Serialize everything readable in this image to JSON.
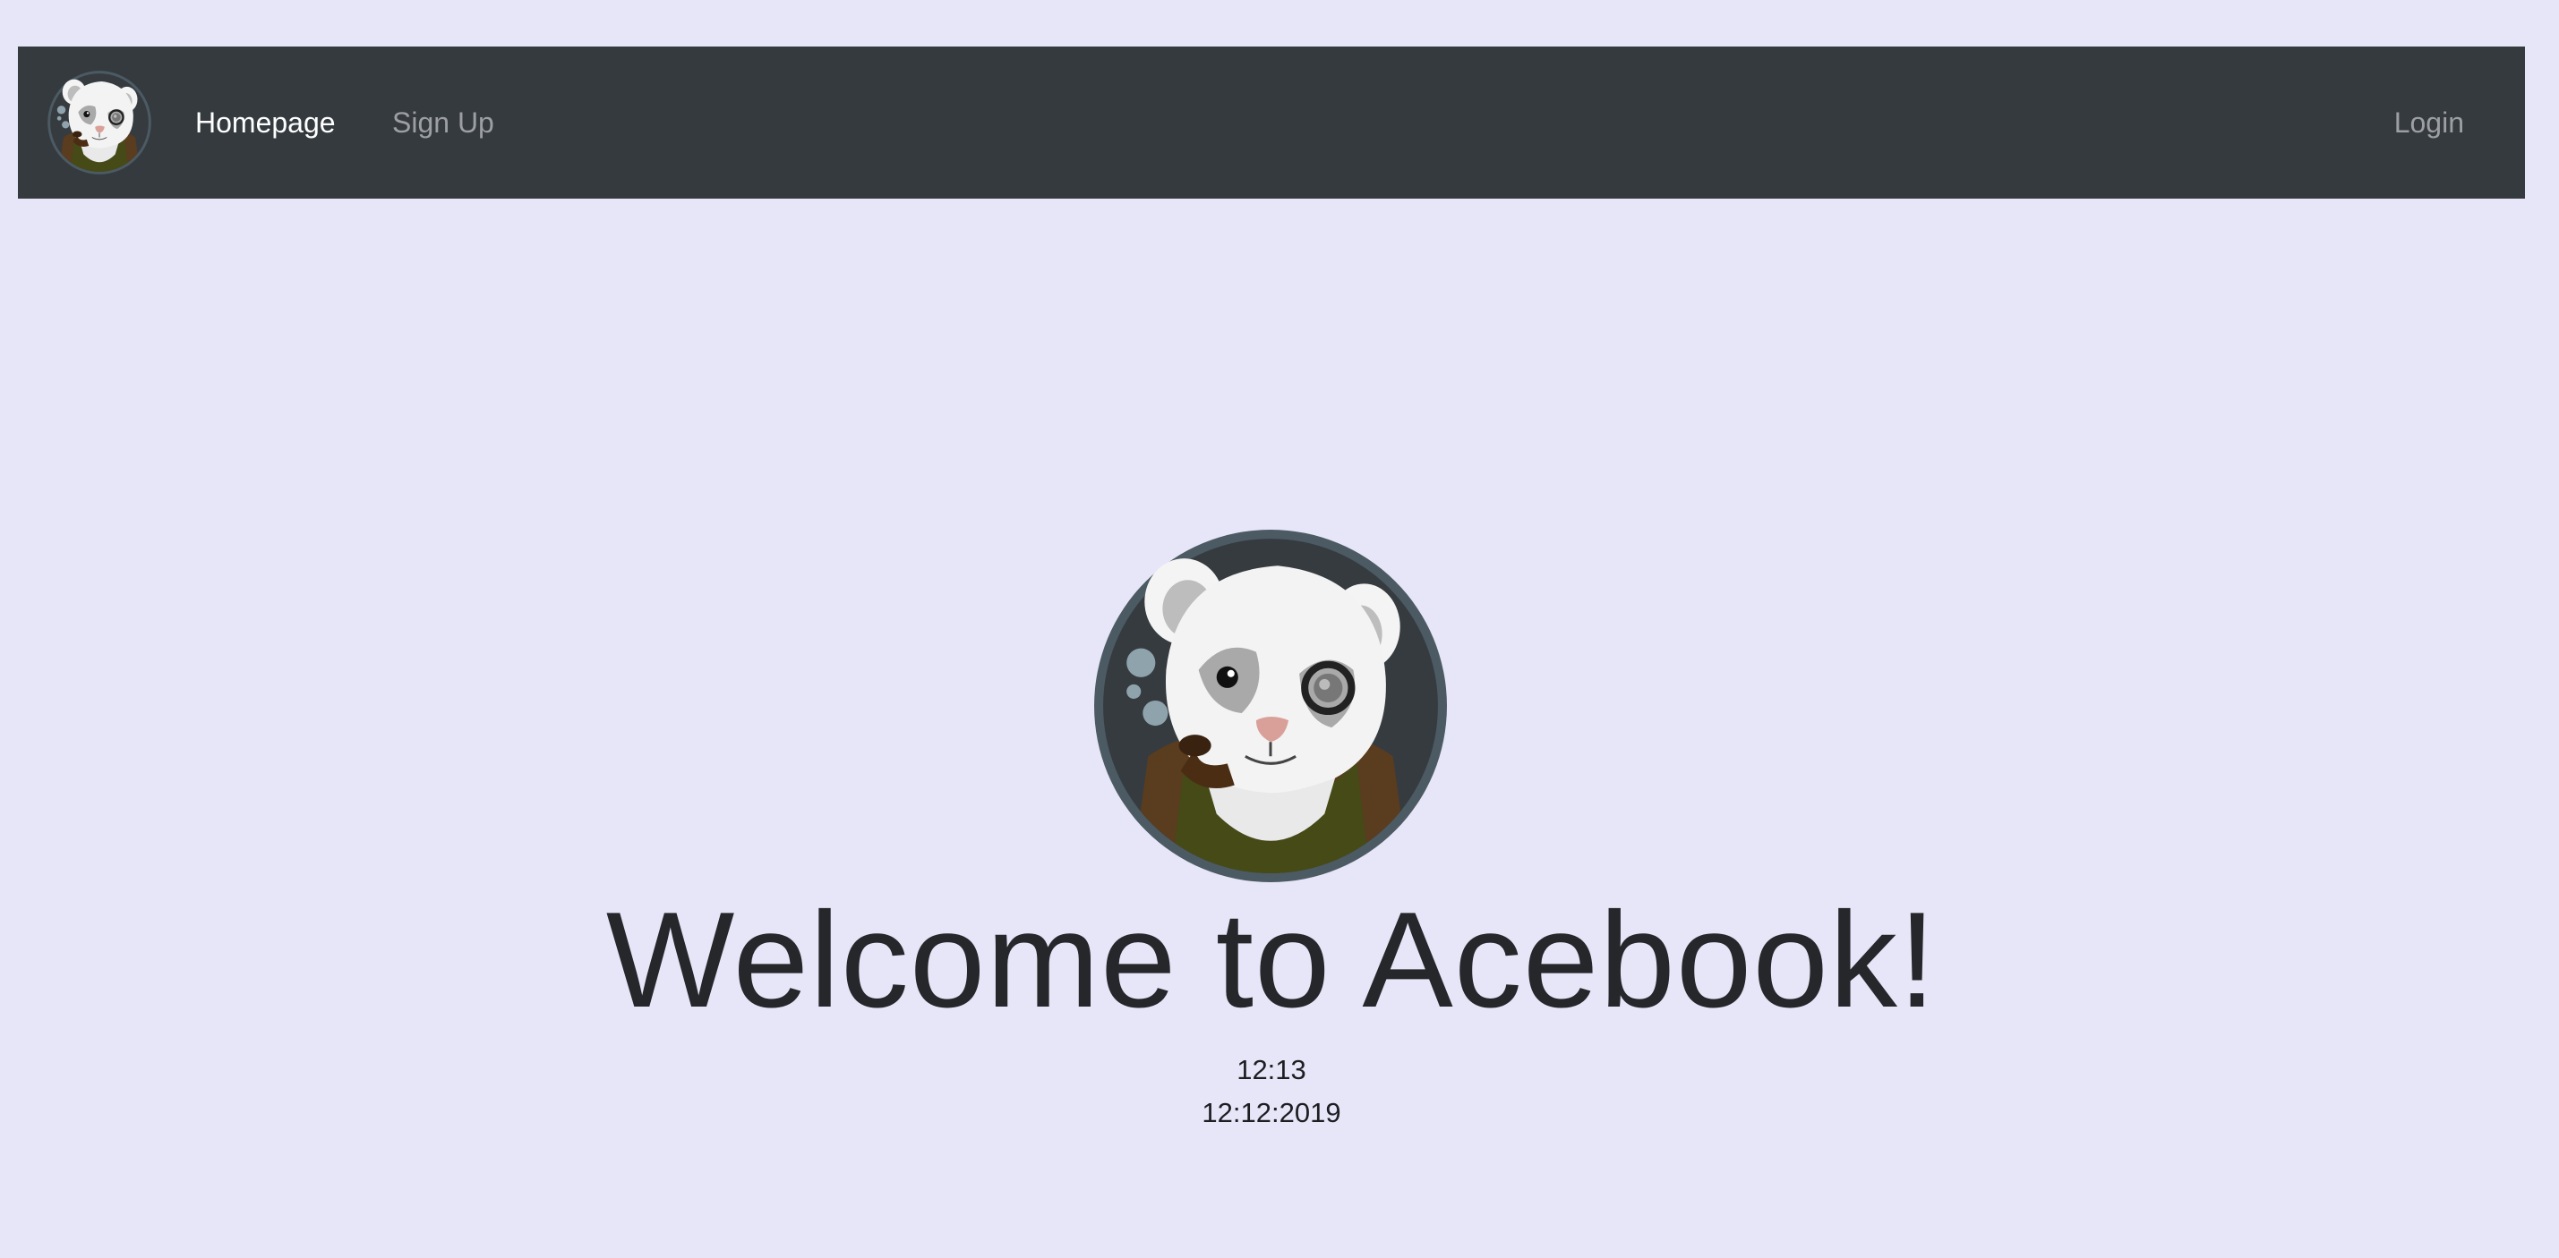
{
  "navbar": {
    "logo_icon": "ferret-monocle-pipe-logo-icon",
    "links": [
      {
        "label": "Homepage",
        "active": true
      },
      {
        "label": "Sign Up",
        "active": false
      }
    ],
    "login_label": "Login",
    "background": "#353a3f"
  },
  "hero": {
    "logo_icon": "ferret-monocle-pipe-logo-icon",
    "title": "Welcome to Acebook!",
    "time": "12:13",
    "date": "12:12:2019"
  },
  "colors": {
    "page_background": "#e7e6f8",
    "nav_active": "#ffffff",
    "nav_inactive": "#9c9fa3",
    "title_text": "#26272b"
  }
}
